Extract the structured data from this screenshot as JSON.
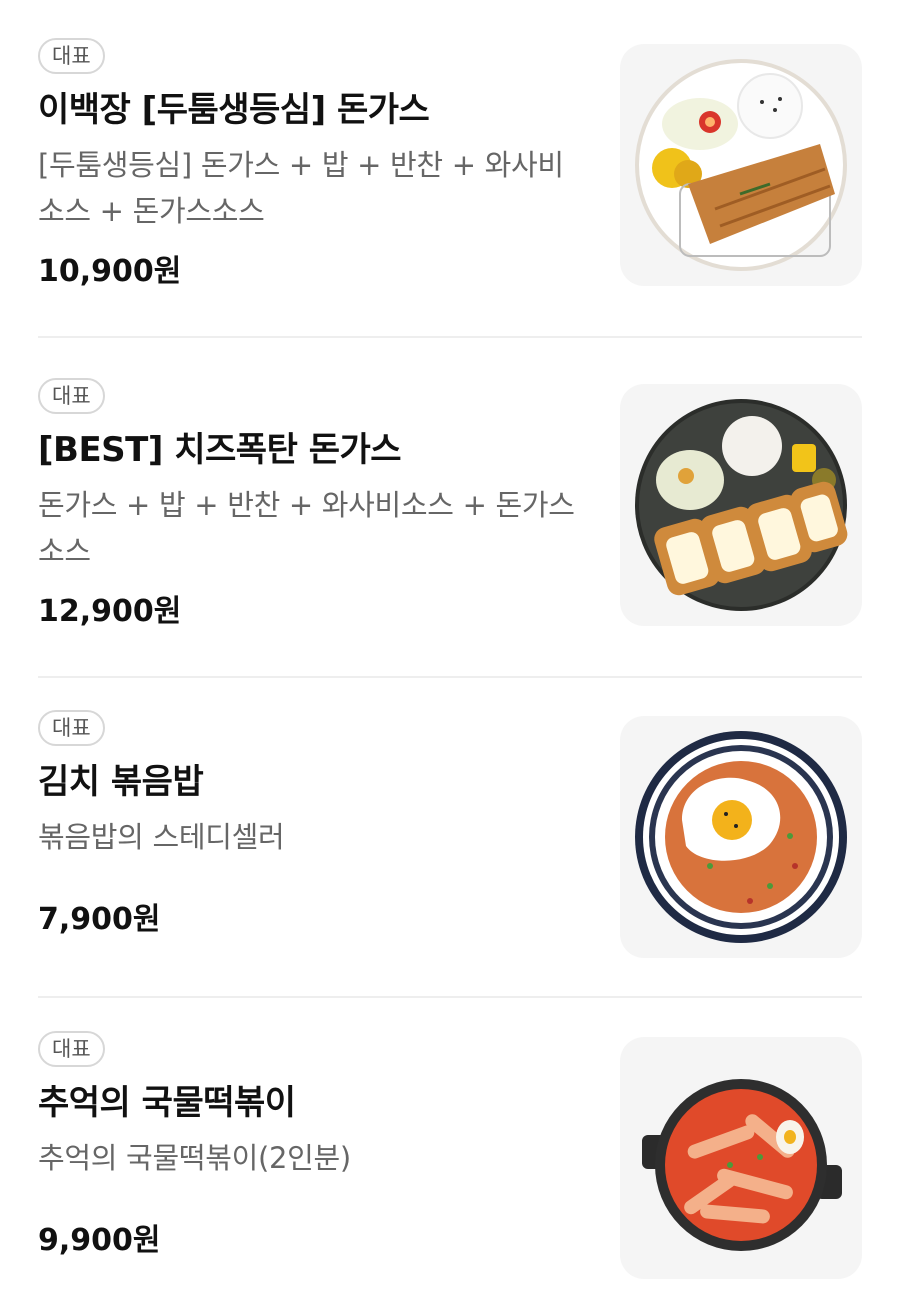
{
  "menu": {
    "items": [
      {
        "badge": "대표",
        "name": "이백장 [두툼생등심] 돈가스",
        "description": "[두툼생등심] 돈가스 + 밥 + 반찬 + 와사비소스 + 돈가스소스",
        "price": "10,900원",
        "image_icon": "pork-cutlet-plate-image"
      },
      {
        "badge": "대표",
        "name": "[BEST] 치즈폭탄 돈가스",
        "description": "돈가스 + 밥 + 반찬 + 와사비소스 + 돈가스소스",
        "price": "12,900원",
        "image_icon": "cheese-cutlet-plate-image"
      },
      {
        "badge": "대표",
        "name": "김치 볶음밥",
        "description": "볶음밥의 스테디셀러",
        "price": "7,900원",
        "image_icon": "kimchi-fried-rice-image"
      },
      {
        "badge": "대표",
        "name": "추억의 국물떡볶이",
        "description": "추억의 국물떡볶이(2인분)",
        "price": "9,900원",
        "image_icon": "tteokbokki-pot-image"
      }
    ]
  },
  "colors": {
    "text_primary": "#111111",
    "text_secondary": "#666666",
    "badge_border": "#d7d7d7",
    "divider": "#eeeeee",
    "thumb_background": "#f5f5f5"
  }
}
